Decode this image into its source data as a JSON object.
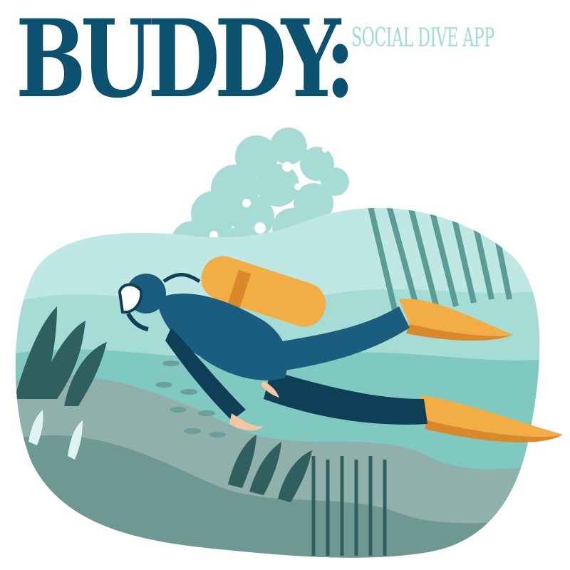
{
  "title": "BUDDY:",
  "subtitle": "SOCIAL DIVE APP",
  "colors": {
    "title": "#0d5170",
    "subtitle": "#9fdcd4",
    "water_light": "#bfe8e4",
    "water_mid": "#7fc9c0",
    "water_dark": "#4e8f8b",
    "rock": "#8fb0ab",
    "plant_dark": "#2f5f5f",
    "wetsuit": "#1a5d7e",
    "wetsuit_dark": "#0e3f57",
    "tank": "#f3ad45",
    "tank_shadow": "#d9882a",
    "skin": "#f4c7a1"
  },
  "icons": {
    "illustration": "scuba-diver-icon"
  }
}
